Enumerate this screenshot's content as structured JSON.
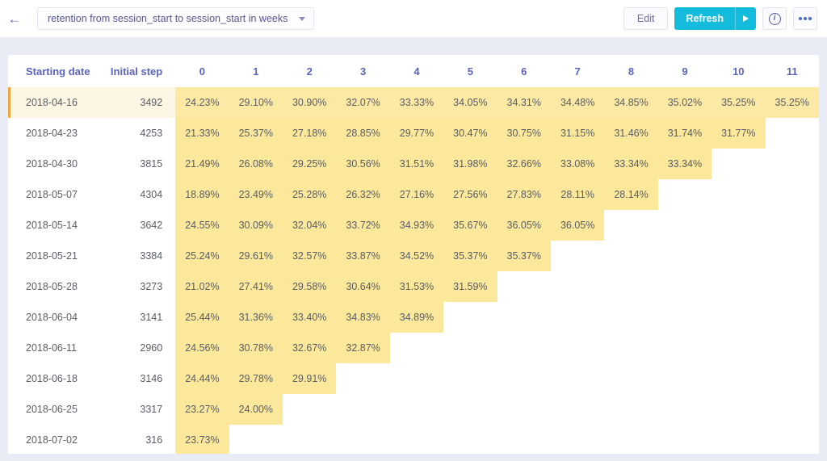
{
  "topbar": {
    "back_icon": "back-arrow-icon",
    "query_title": "retention from session_start to session_start in weeks",
    "chevron_icon": "chevron-down-icon",
    "edit_label": "Edit",
    "refresh_label": "Refresh",
    "run_icon": "play-icon",
    "info_icon": "info-icon",
    "info_glyph": "i",
    "more_icon": "ellipsis-icon"
  },
  "table": {
    "headers": {
      "date": "Starting date",
      "initial_step": "Initial step",
      "periods": [
        "0",
        "1",
        "2",
        "3",
        "4",
        "5",
        "6",
        "7",
        "8",
        "9",
        "10",
        "11"
      ]
    },
    "rows": [
      {
        "date": "2018-04-16",
        "initial_step": "3492",
        "highlighted": true,
        "values": [
          "24.23%",
          "29.10%",
          "30.90%",
          "32.07%",
          "33.33%",
          "34.05%",
          "34.31%",
          "34.48%",
          "34.85%",
          "35.02%",
          "35.25%",
          "35.25%"
        ]
      },
      {
        "date": "2018-04-23",
        "initial_step": "4253",
        "highlighted": false,
        "values": [
          "21.33%",
          "25.37%",
          "27.18%",
          "28.85%",
          "29.77%",
          "30.47%",
          "30.75%",
          "31.15%",
          "31.46%",
          "31.74%",
          "31.77%"
        ]
      },
      {
        "date": "2018-04-30",
        "initial_step": "3815",
        "highlighted": false,
        "values": [
          "21.49%",
          "26.08%",
          "29.25%",
          "30.56%",
          "31.51%",
          "31.98%",
          "32.66%",
          "33.08%",
          "33.34%",
          "33.34%"
        ]
      },
      {
        "date": "2018-05-07",
        "initial_step": "4304",
        "highlighted": false,
        "values": [
          "18.89%",
          "23.49%",
          "25.28%",
          "26.32%",
          "27.16%",
          "27.56%",
          "27.83%",
          "28.11%",
          "28.14%"
        ]
      },
      {
        "date": "2018-05-14",
        "initial_step": "3642",
        "highlighted": false,
        "values": [
          "24.55%",
          "30.09%",
          "32.04%",
          "33.72%",
          "34.93%",
          "35.67%",
          "36.05%",
          "36.05%"
        ]
      },
      {
        "date": "2018-05-21",
        "initial_step": "3384",
        "highlighted": false,
        "values": [
          "25.24%",
          "29.61%",
          "32.57%",
          "33.87%",
          "34.52%",
          "35.37%",
          "35.37%"
        ]
      },
      {
        "date": "2018-05-28",
        "initial_step": "3273",
        "highlighted": false,
        "values": [
          "21.02%",
          "27.41%",
          "29.58%",
          "30.64%",
          "31.53%",
          "31.59%"
        ]
      },
      {
        "date": "2018-06-04",
        "initial_step": "3141",
        "highlighted": false,
        "values": [
          "25.44%",
          "31.36%",
          "33.40%",
          "34.83%",
          "34.89%"
        ]
      },
      {
        "date": "2018-06-11",
        "initial_step": "2960",
        "highlighted": false,
        "values": [
          "24.56%",
          "30.78%",
          "32.67%",
          "32.87%"
        ]
      },
      {
        "date": "2018-06-18",
        "initial_step": "3146",
        "highlighted": false,
        "values": [
          "24.44%",
          "29.78%",
          "29.91%"
        ]
      },
      {
        "date": "2018-06-25",
        "initial_step": "3317",
        "highlighted": false,
        "values": [
          "23.27%",
          "24.00%"
        ]
      },
      {
        "date": "2018-07-02",
        "initial_step": "316",
        "highlighted": false,
        "values": [
          "23.73%"
        ]
      }
    ]
  },
  "colors": {
    "accent": "#13bcdd",
    "cell_fill": "#fbe89a",
    "highlight_row": "#fdf6e3",
    "highlight_bar": "#f0a83c",
    "header_text": "#5b63bd",
    "page_bg": "#e9ecf4"
  }
}
